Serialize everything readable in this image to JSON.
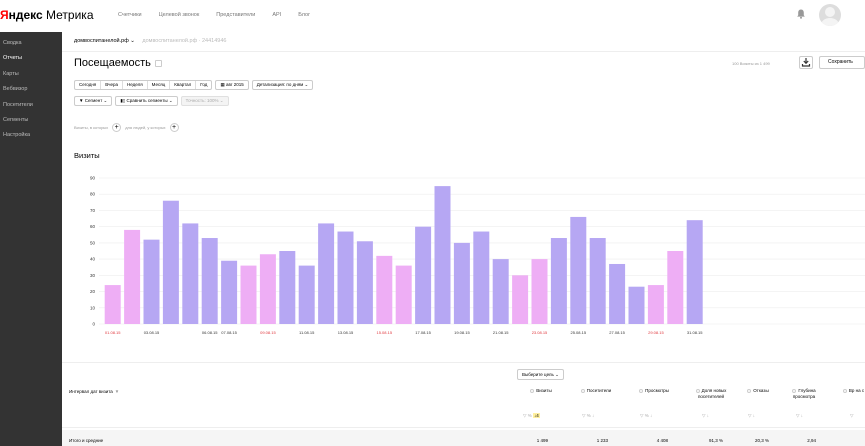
{
  "header": {
    "logo_ya": "Я",
    "logo_ndex": "ндекс",
    "logo_metrika": " Метрика",
    "nav": [
      "Счетчики",
      "Целевой звонок",
      "Представители",
      "API",
      "Блог"
    ],
    "bell_icon": "bell-icon",
    "avatar_icon": "user-avatar-icon"
  },
  "sidebar": {
    "items": [
      {
        "label": "Сводка",
        "active": false
      },
      {
        "label": "Отчеты",
        "active": true
      },
      {
        "label": "Карты",
        "active": false
      },
      {
        "label": "Вебвизор",
        "active": false
      },
      {
        "label": "Посетители",
        "active": false
      },
      {
        "label": "Сегменты",
        "active": false
      },
      {
        "label": "Настройка",
        "active": false
      }
    ]
  },
  "breadcrumb": {
    "site": "домвоспитанелой.рф",
    "counter": "домвоспитанелой.рф · 24414946"
  },
  "report": {
    "title": "Посещаемость",
    "limit": "100 Визиты из 1 499",
    "save_label": "Сохранить"
  },
  "periods": [
    "Сегодня",
    "Вчера",
    "Неделя",
    "Месяц",
    "Квартал",
    "Год"
  ],
  "date_range": "авг 2015",
  "detail_label": "Детализация: по дням",
  "filters": {
    "segment": "Сегмент",
    "compare": "Сравнить сегменты",
    "accuracy": "Точность: 100%"
  },
  "segment_row": {
    "visits_where": "Визиты, в которых",
    "for_visitors": "для людей, у которых"
  },
  "chart_title": "Визиты",
  "chart_data": {
    "type": "bar",
    "title": "Визиты",
    "ylim": [
      0,
      90
    ],
    "yticks": [
      0,
      10,
      20,
      30,
      40,
      50,
      60,
      70,
      80,
      90
    ],
    "grid": true,
    "colors": {
      "weekday": "#b6a7f3",
      "weekend": "#eeaef5",
      "weekday_label": "#333333",
      "weekend_label": "#e0383e"
    },
    "categories": [
      "01.08.15",
      "02.08.15",
      "03.08.15",
      "04.08.15",
      "05.08.15",
      "06.08.15",
      "07.08.15",
      "08.08.15",
      "09.08.15",
      "10.08.15",
      "11.08.15",
      "12.08.15",
      "13.08.15",
      "14.08.15",
      "15.08.15",
      "16.08.15",
      "17.08.15",
      "18.08.15",
      "19.08.15",
      "20.08.15",
      "21.08.15",
      "22.08.15",
      "23.08.15",
      "24.08.15",
      "25.08.15",
      "26.08.15",
      "27.08.15",
      "28.08.15",
      "29.08.15",
      "30.08.15",
      "31.08.15"
    ],
    "values": [
      24,
      58,
      52,
      76,
      62,
      53,
      39,
      36,
      43,
      45,
      36,
      62,
      57,
      51,
      42,
      36,
      60,
      85,
      50,
      57,
      40,
      30,
      40,
      53,
      66,
      53,
      37,
      23,
      24,
      45,
      64
    ],
    "weekend": [
      true,
      true,
      false,
      false,
      false,
      false,
      false,
      true,
      true,
      false,
      false,
      false,
      false,
      false,
      true,
      true,
      false,
      false,
      false,
      false,
      false,
      true,
      true,
      false,
      false,
      false,
      false,
      false,
      true,
      true,
      false
    ],
    "xlabels_shown": [
      "01.08.15",
      "03.08.15",
      "06.08.15",
      "07.08.15",
      "09.08.15",
      "11.08.15",
      "13.08.15",
      "15.08.15",
      "17.08.15",
      "19.08.15",
      "21.08.15",
      "23.08.15",
      "25.08.15",
      "27.08.15",
      "29.08.15",
      "31.08.15"
    ]
  },
  "table": {
    "goal_button": "Выберите цель",
    "grouping_label": "Интервал дат визита",
    "grouping_sort": "▼",
    "columns": [
      {
        "label": "Визиты",
        "total": "1 499",
        "active": true
      },
      {
        "label": "Посетители",
        "total": "1 233"
      },
      {
        "label": "Просмотры",
        "total": "4 408"
      },
      {
        "label": "Доля новых посетителей",
        "total": "91,3 %"
      },
      {
        "label": "Отказы",
        "total": "20,3 %"
      },
      {
        "label": "Глубина просмотра",
        "total": "2,94"
      },
      {
        "label": "Вр на с",
        "total": ""
      }
    ],
    "total_label": "Итого и средние"
  }
}
